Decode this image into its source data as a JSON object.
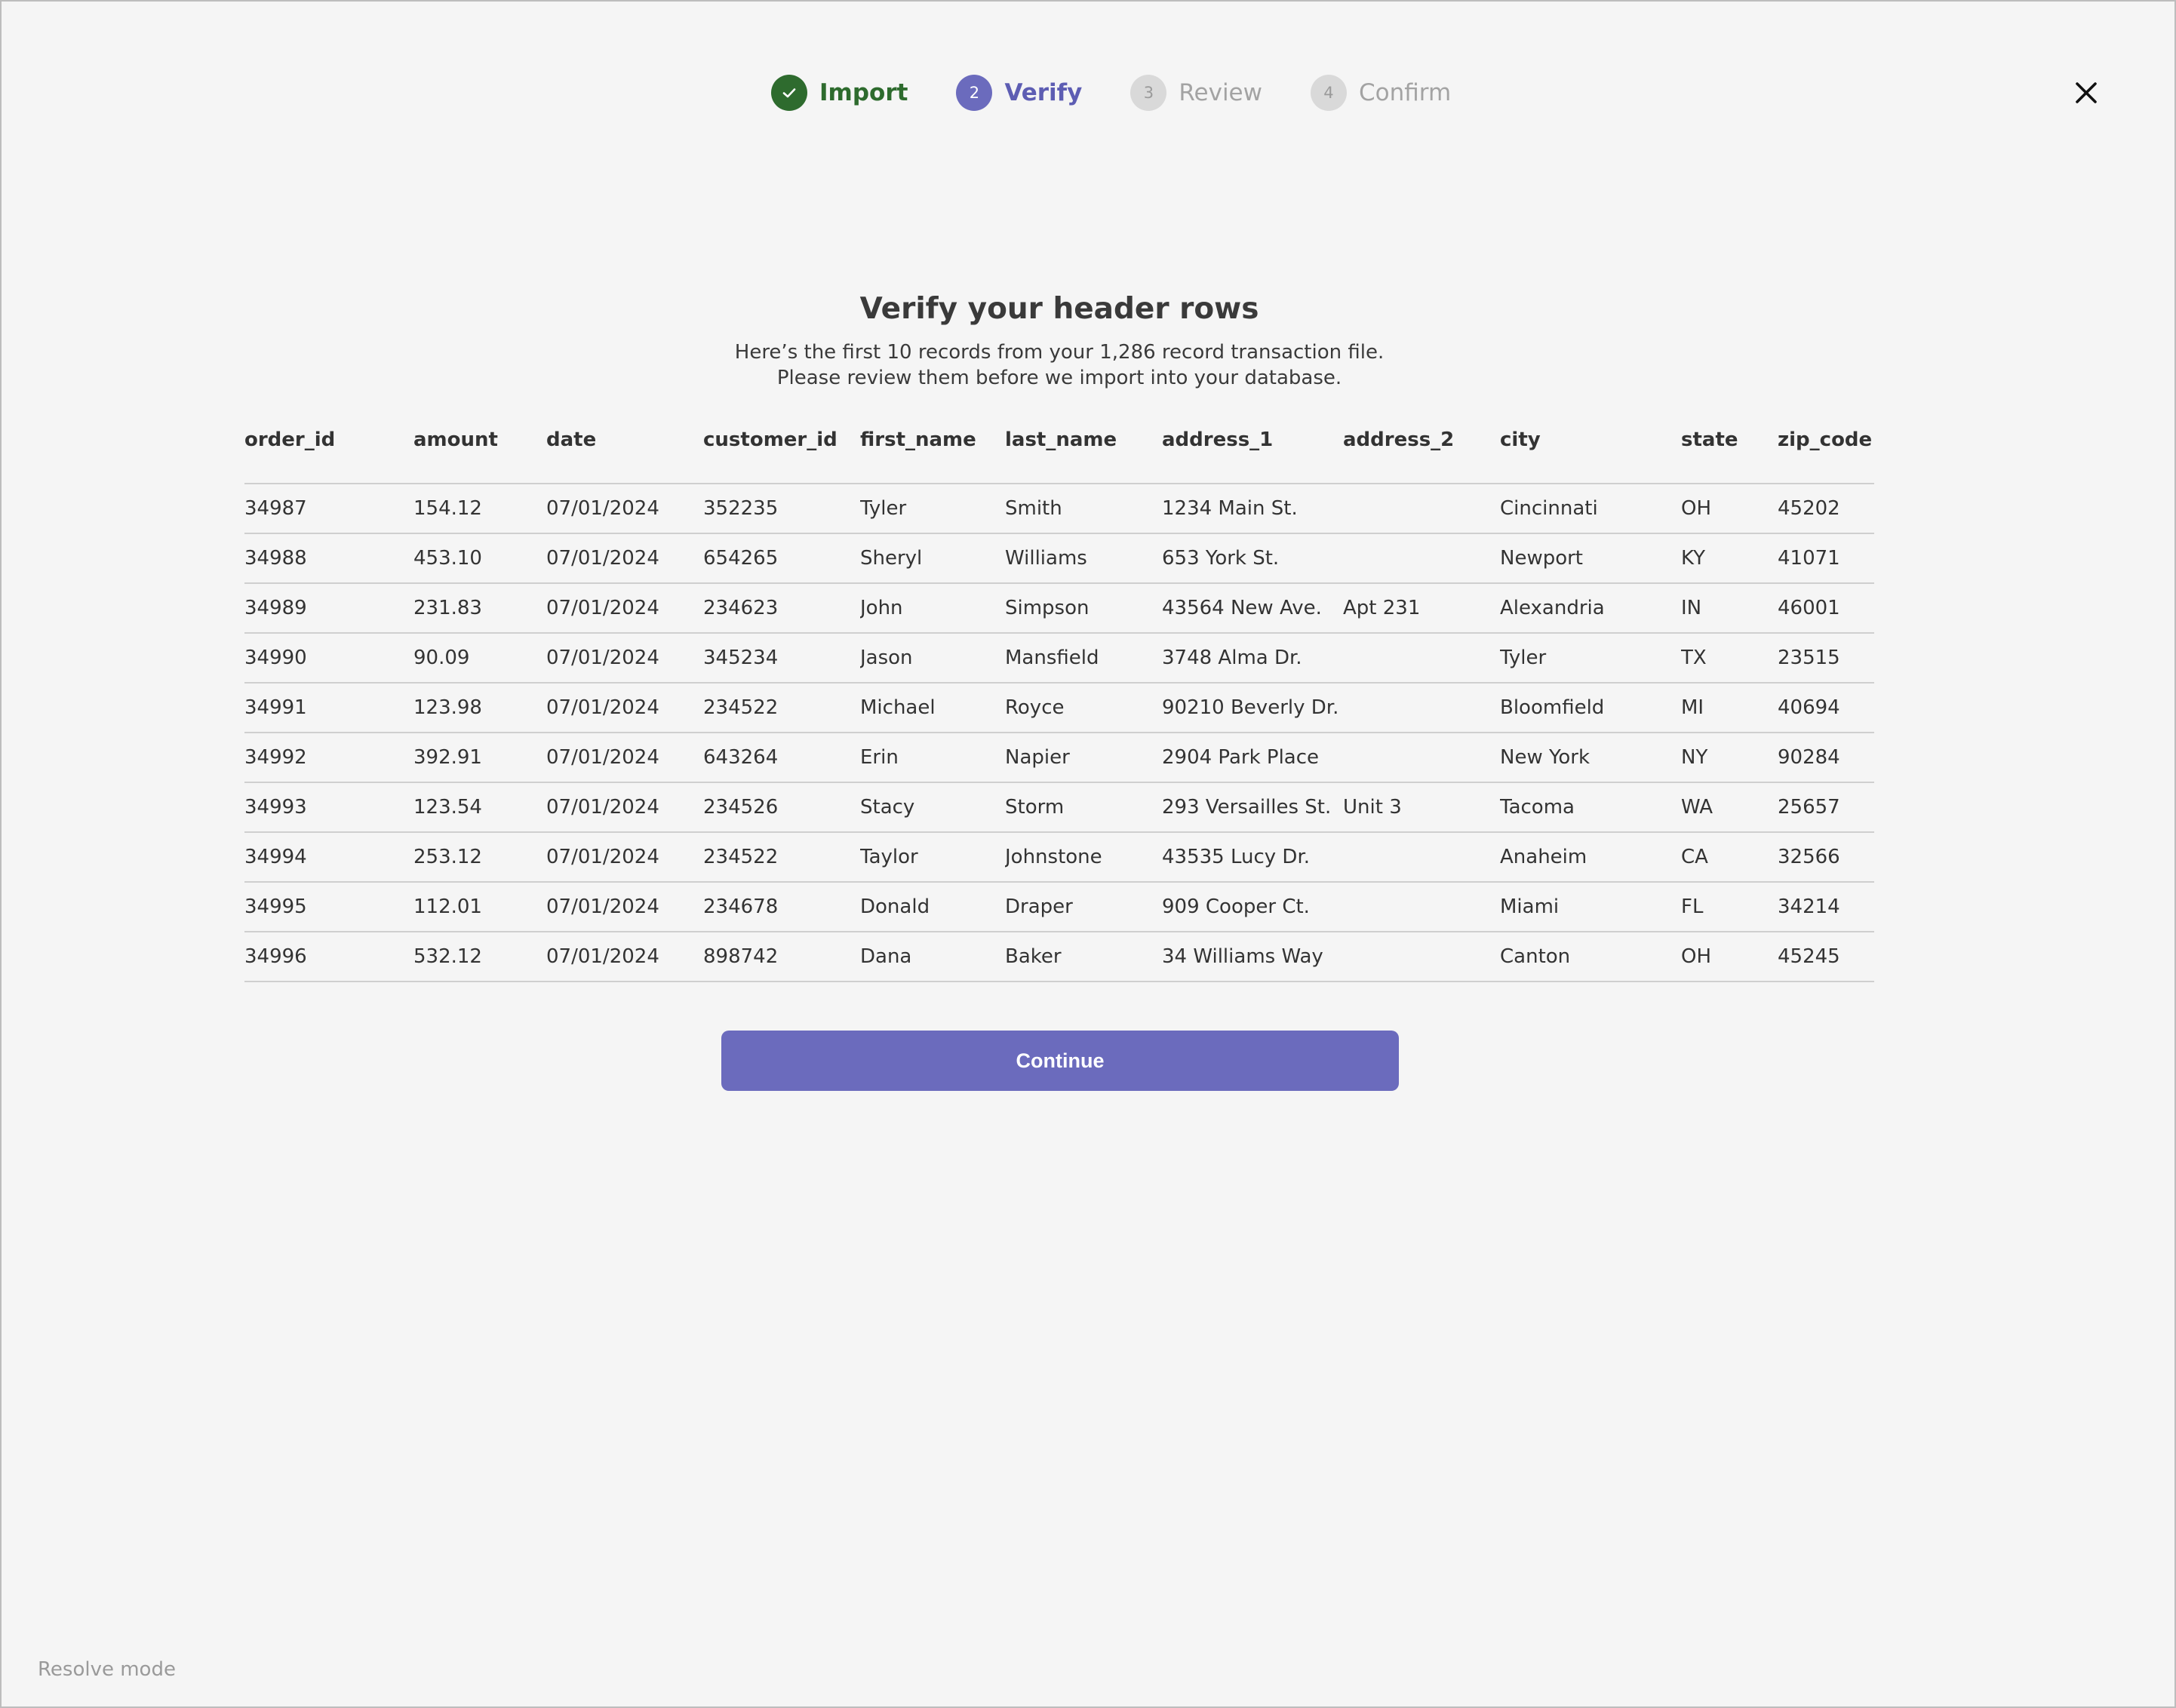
{
  "stepper": {
    "steps": [
      {
        "number": "✓",
        "label": "Import",
        "state": "done"
      },
      {
        "number": "2",
        "label": "Verify",
        "state": "active"
      },
      {
        "number": "3",
        "label": "Review",
        "state": "todo"
      },
      {
        "number": "4",
        "label": "Confirm",
        "state": "todo"
      }
    ]
  },
  "close_icon": "close-icon",
  "main": {
    "title": "Verify your header rows",
    "subtitle_line1": "Here’s the first 10 records from your 1,286 record transaction file.",
    "subtitle_line2": "Please review them before we import into your database."
  },
  "table": {
    "columns": [
      "order_id",
      "amount",
      "date",
      "customer_id",
      "first_name",
      "last_name",
      "address_1",
      "address_2",
      "city",
      "state",
      "zip_code"
    ],
    "rows": [
      [
        "34987",
        "154.12",
        "07/01/2024",
        "352235",
        "Tyler",
        "Smith",
        "1234 Main St.",
        "",
        "Cincinnati",
        "OH",
        "45202"
      ],
      [
        "34988",
        "453.10",
        "07/01/2024",
        "654265",
        "Sheryl",
        "Williams",
        "653 York St.",
        "",
        "Newport",
        "KY",
        "41071"
      ],
      [
        "34989",
        "231.83",
        "07/01/2024",
        "234623",
        "John",
        "Simpson",
        "43564 New Ave.",
        "Apt 231",
        "Alexandria",
        "IN",
        "46001"
      ],
      [
        "34990",
        "90.09",
        "07/01/2024",
        "345234",
        "Jason",
        "Mansfield",
        "3748 Alma Dr.",
        "",
        "Tyler",
        "TX",
        "23515"
      ],
      [
        "34991",
        "123.98",
        "07/01/2024",
        "234522",
        "Michael",
        "Royce",
        "90210 Beverly Dr.",
        "",
        "Bloomfield",
        "MI",
        "40694"
      ],
      [
        "34992",
        "392.91",
        "07/01/2024",
        "643264",
        "Erin",
        "Napier",
        "2904 Park Place",
        "",
        "New York",
        "NY",
        "90284"
      ],
      [
        "34993",
        "123.54",
        "07/01/2024",
        "234526",
        "Stacy",
        "Storm",
        "293 Versailles St.",
        "Unit 3",
        "Tacoma",
        "WA",
        "25657"
      ],
      [
        "34994",
        "253.12",
        "07/01/2024",
        "234522",
        "Taylor",
        "Johnstone",
        "43535 Lucy Dr.",
        "",
        "Anaheim",
        "CA",
        "32566"
      ],
      [
        "34995",
        "112.01",
        "07/01/2024",
        "234678",
        "Donald",
        "Draper",
        "909 Cooper Ct.",
        "",
        "Miami",
        "FL",
        "34214"
      ],
      [
        "34996",
        "532.12",
        "07/01/2024",
        "898742",
        "Dana",
        "Baker",
        "34 Williams Way",
        "",
        "Canton",
        "OH",
        "45245"
      ]
    ]
  },
  "actions": {
    "continue_label": "Continue"
  },
  "footer": {
    "mode_label": "Resolve mode"
  },
  "colors": {
    "accent": "#6b6bbd",
    "success": "#2e6b2e",
    "background": "#f5f5f5"
  }
}
